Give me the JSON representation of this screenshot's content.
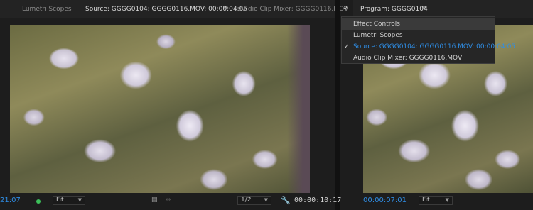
{
  "left_panel": {
    "tabs": [
      {
        "label": "Lumetri Scopes"
      },
      {
        "label": "Source: GGGG0104: GGGG0116.MOV: 00:00:04:05"
      },
      {
        "label": "Audio Clip Mixer: GGGG0116.MOV"
      }
    ],
    "menu_glyph": "≡",
    "overflow_glyph": "»",
    "controls": {
      "timecode_left": "21:07",
      "fit_label": "Fit",
      "resolution_label": "1/2",
      "timecode_right": "00:00:10:17"
    }
  },
  "right_panel": {
    "tab_label": "Program: GGGG0104",
    "menu_glyph": "≡",
    "controls": {
      "timecode": "00:00:07:01",
      "fit_label": "Fit"
    }
  },
  "workspace_menu": {
    "items": [
      {
        "label": "Effect Controls",
        "state": "hover"
      },
      {
        "label": "Lumetri Scopes",
        "state": "normal"
      },
      {
        "label": "Source: GGGG0104: GGGG0116.MOV: 00:00:04:05",
        "state": "checked"
      },
      {
        "label": "Audio Clip Mixer: GGGG0116.MOV",
        "state": "normal"
      }
    ],
    "check_glyph": "✓"
  },
  "colors": {
    "timecode_blue": "#2f8ee6",
    "background": "#1d1d1d",
    "status_green": "#3cc05a"
  },
  "icons": {
    "chevron_down": "chevron-down-icon",
    "wrench": "wrench-icon",
    "export_frame": "export-frame-icon",
    "overflow": "chevron-double-right-icon"
  }
}
